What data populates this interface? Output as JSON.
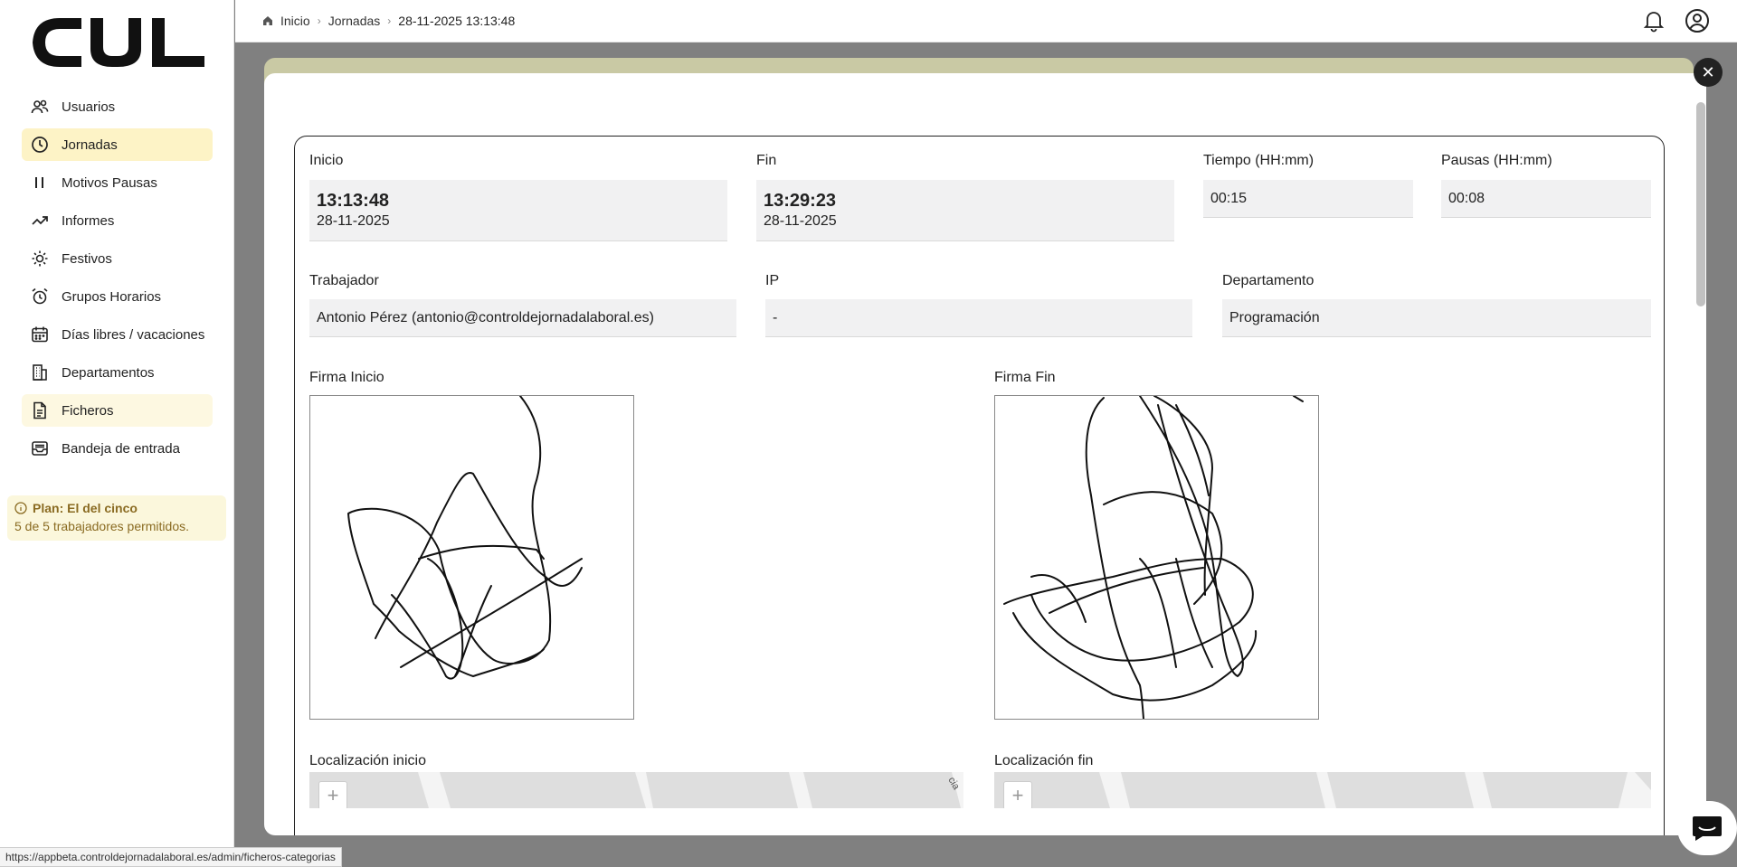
{
  "app": {
    "logo_text": "CJL"
  },
  "sidebar": {
    "items": [
      {
        "label": "Usuarios",
        "icon": "users-icon"
      },
      {
        "label": "Jornadas",
        "icon": "clock-icon"
      },
      {
        "label": "Motivos Pausas",
        "icon": "pause-icon"
      },
      {
        "label": "Informes",
        "icon": "trend-icon"
      },
      {
        "label": "Festivos",
        "icon": "sun-icon"
      },
      {
        "label": "Grupos Horarios",
        "icon": "alarm-icon"
      },
      {
        "label": "Días libres / vacaciones",
        "icon": "calendar-icon"
      },
      {
        "label": "Departamentos",
        "icon": "building-icon"
      },
      {
        "label": "Ficheros",
        "icon": "file-icon"
      },
      {
        "label": "Bandeja de entrada",
        "icon": "inbox-icon"
      }
    ],
    "plan": {
      "title": "Plan: El del cinco",
      "detail": "5 de 5 trabajadores permitidos."
    }
  },
  "topbar": {
    "breadcrumb": [
      "Inicio",
      "Jornadas",
      "28-11-2025 13:13:48"
    ]
  },
  "record": {
    "inicio": {
      "label": "Inicio",
      "time": "13:13:48",
      "date": "28-11-2025"
    },
    "fin": {
      "label": "Fin",
      "time": "13:29:23",
      "date": "28-11-2025"
    },
    "tiempo": {
      "label": "Tiempo (HH:mm)",
      "value": "00:15"
    },
    "pausas": {
      "label": "Pausas (HH:mm)",
      "value": "00:08"
    },
    "trabajador": {
      "label": "Trabajador",
      "value": "Antonio Pérez (antonio@controldejornadalaboral.es)"
    },
    "ip": {
      "label": "IP",
      "value": "-"
    },
    "departamento": {
      "label": "Departamento",
      "value": "Programación"
    },
    "firma_inicio": {
      "label": "Firma Inicio"
    },
    "firma_fin": {
      "label": "Firma Fin"
    },
    "loc_inicio": {
      "label": "Localización inicio",
      "map_text": "cia"
    },
    "loc_fin": {
      "label": "Localización fin"
    },
    "zoom_in": "+"
  },
  "status_bar": {
    "url": "https://appbeta.controldejornadalaboral.es/admin/ficheros-categorias"
  },
  "colors": {
    "active_nav": "#fdf3c6",
    "plan_bg": "#fbf7dc",
    "plan_text": "#8a6b22"
  }
}
